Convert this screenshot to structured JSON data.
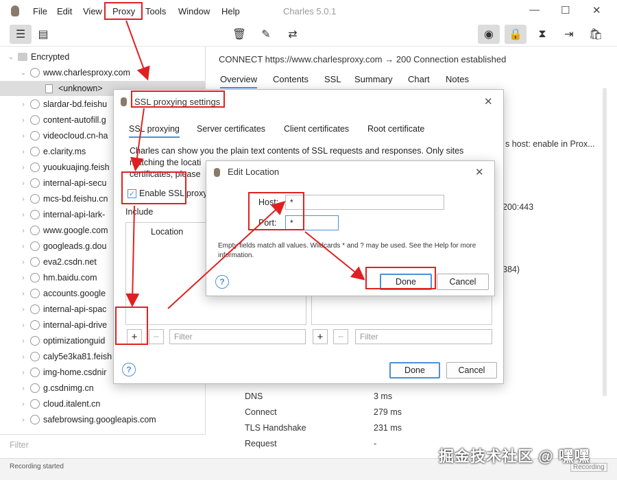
{
  "menubar": {
    "items": [
      "File",
      "Edit",
      "View",
      "Proxy",
      "Tools",
      "Window",
      "Help"
    ],
    "title": "Charles 5.0.1",
    "controls": [
      "minimize",
      "maximize",
      "close"
    ]
  },
  "toolbar": {
    "icons": [
      "list-icon",
      "grid-icon",
      "trash-icon",
      "edit-icon",
      "repeat-icon",
      "record-icon",
      "lock-icon",
      "hourglass-icon",
      "step-icon",
      "bag-icon"
    ]
  },
  "tree": {
    "root": "Encrypted",
    "host": "www.charlesproxy.com",
    "child": "<unknown>",
    "items": [
      "slardar-bd.feishu",
      "content-autofill.g",
      "videocloud.cn-ha",
      "e.clarity.ms",
      "yuoukuajing.feish",
      "internal-api-secu",
      "mcs-bd.feishu.cn",
      "internal-api-lark-",
      "www.google.com",
      "googleads.g.dou",
      "eva2.csdn.net",
      "hm.baidu.com",
      "accounts.google",
      "internal-api-spac",
      "internal-api-drive",
      "optimizationguid",
      "caly5e3ka81.feish",
      "img-home.csdnir",
      "g.csdnimg.cn",
      "cloud.italent.cn",
      "safebrowsing.googleapis.com"
    ],
    "filter_placeholder": "Filter"
  },
  "status": {
    "text": "Recording started",
    "badge": "Recording"
  },
  "right": {
    "connect_line": "CONNECT https://www.charlesproxy.com → 200 Connection established",
    "tabs": [
      "Overview",
      "Contents",
      "SSL",
      "Summary",
      "Chart",
      "Notes"
    ],
    "partial_texts": [
      "s host: enable in Prox...",
      "200:443",
      "384)"
    ],
    "timings": [
      {
        "label": "DNS",
        "value": "3 ms"
      },
      {
        "label": "Connect",
        "value": "279 ms"
      },
      {
        "label": "TLS Handshake",
        "value": "231 ms"
      },
      {
        "label": "Request",
        "value": "-"
      }
    ]
  },
  "ssl_dialog": {
    "title": "SSL proxying settings",
    "tabs": [
      "SSL proxying",
      "Server certificates",
      "Client certificates",
      "Root certificate"
    ],
    "description_line1": "Charles can show you the plain text contents of SSL requests and responses. Only sites",
    "description_line2": "matching the locati",
    "description_line3": "certificates, please",
    "enable_label": "Enable SSL proxy",
    "include_label": "Include",
    "location_header": "Location",
    "add_label": "+",
    "remove_label": "−",
    "filter_placeholder": "Filter",
    "done_label": "Done",
    "cancel_label": "Cancel",
    "help_label": "?"
  },
  "edit_dialog": {
    "title": "Edit Location",
    "host_label": "Host:",
    "host_value": "*",
    "port_label": "Port:",
    "port_value": "*",
    "hint": "Empty fields match all values. Wildcards * and ? may be used. See the Help for more information.",
    "done_label": "Done",
    "cancel_label": "Cancel",
    "help_label": "?"
  },
  "watermark": "掘金技术社区 @ 嘿嘿",
  "colors": {
    "annotation_red": "#e02020",
    "accent_blue": "#4a90d9"
  }
}
